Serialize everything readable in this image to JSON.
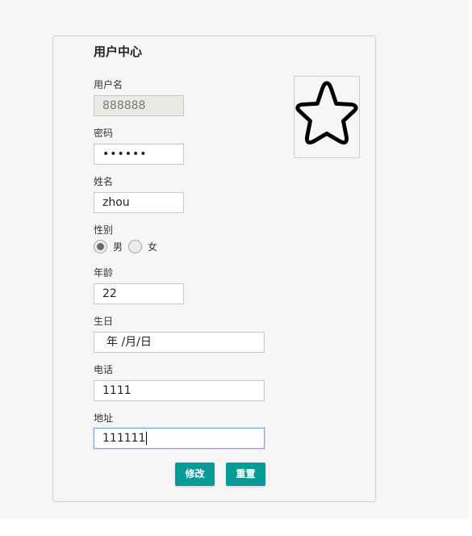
{
  "form": {
    "title": "用户中心",
    "username": {
      "label": "用户名",
      "value": "888888"
    },
    "password": {
      "label": "密码",
      "value": "••••••"
    },
    "name": {
      "label": "姓名",
      "value": "zhou"
    },
    "gender": {
      "label": "性别",
      "options": [
        "男",
        "女"
      ],
      "selected": "男"
    },
    "age": {
      "label": "年龄",
      "value": "22"
    },
    "birthday": {
      "label": "生日",
      "placeholder": "年 /月/日"
    },
    "phone": {
      "label": "电话",
      "value": "1111"
    },
    "address": {
      "label": "地址",
      "value": "111111"
    },
    "buttons": {
      "modify": "修改",
      "reset": "重置"
    }
  },
  "avatar": {
    "icon": "star-outline-icon"
  },
  "colors": {
    "accent": "#0a9a96",
    "page_background": "#f6f6f6",
    "readonly_field": "#ebebe6",
    "focus_border": "#7aa7e0"
  }
}
